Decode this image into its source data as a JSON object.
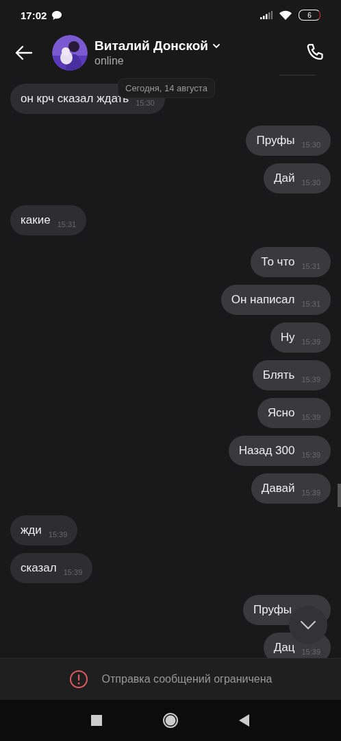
{
  "status_bar": {
    "time": "17:02",
    "battery": "6"
  },
  "header": {
    "name": "Виталий Донской",
    "status": "online"
  },
  "date_pill": "Сегодня, 14 августа",
  "messages": [
    {
      "kind": "incoming",
      "text": "он крч сказал ждать",
      "time": "15:30"
    },
    {
      "kind": "outgoing",
      "text": "Пруфы",
      "time": "15:30"
    },
    {
      "kind": "outgoing",
      "text": "Дай",
      "time": "15:30"
    },
    {
      "kind": "incoming",
      "text": "какие",
      "time": "15:31"
    },
    {
      "kind": "outgoing",
      "text": "То что",
      "time": "15:31"
    },
    {
      "kind": "outgoing",
      "text": "Он написал",
      "time": "15:31"
    },
    {
      "kind": "outgoing",
      "text": "Ну",
      "time": "15:39"
    },
    {
      "kind": "outgoing",
      "text": "Блять",
      "time": "15:39"
    },
    {
      "kind": "outgoing",
      "text": "Ясно",
      "time": "15:39"
    },
    {
      "kind": "outgoing",
      "text": "Назад 300",
      "time": "15:39"
    },
    {
      "kind": "outgoing",
      "text": "Давай",
      "time": "15:39"
    },
    {
      "kind": "incoming",
      "text": "жди",
      "time": "15:39"
    },
    {
      "kind": "incoming",
      "text": "сказал",
      "time": "15:39"
    },
    {
      "kind": "outgoing",
      "text": "Пруфы"
    },
    {
      "kind": "outgoing",
      "text": "Дац",
      "time": "15:39"
    }
  ],
  "notice": "Отправка сообщений ограничена"
}
